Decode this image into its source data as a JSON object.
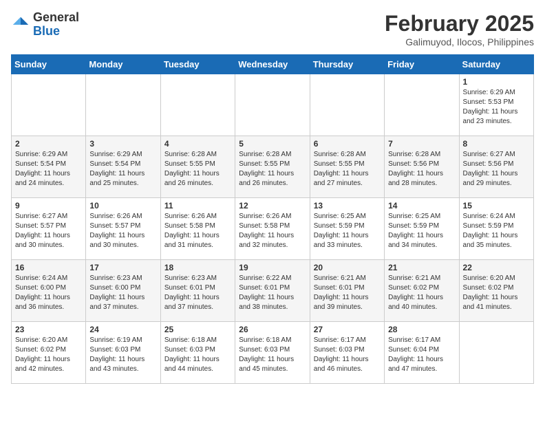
{
  "header": {
    "logo_line1": "General",
    "logo_line2": "Blue",
    "title": "February 2025",
    "subtitle": "Galimuyod, Ilocos, Philippines"
  },
  "calendar": {
    "days_of_week": [
      "Sunday",
      "Monday",
      "Tuesday",
      "Wednesday",
      "Thursday",
      "Friday",
      "Saturday"
    ],
    "weeks": [
      [
        {
          "day": "",
          "info": ""
        },
        {
          "day": "",
          "info": ""
        },
        {
          "day": "",
          "info": ""
        },
        {
          "day": "",
          "info": ""
        },
        {
          "day": "",
          "info": ""
        },
        {
          "day": "",
          "info": ""
        },
        {
          "day": "1",
          "info": "Sunrise: 6:29 AM\nSunset: 5:53 PM\nDaylight: 11 hours and 23 minutes."
        }
      ],
      [
        {
          "day": "2",
          "info": "Sunrise: 6:29 AM\nSunset: 5:54 PM\nDaylight: 11 hours and 24 minutes."
        },
        {
          "day": "3",
          "info": "Sunrise: 6:29 AM\nSunset: 5:54 PM\nDaylight: 11 hours and 25 minutes."
        },
        {
          "day": "4",
          "info": "Sunrise: 6:28 AM\nSunset: 5:55 PM\nDaylight: 11 hours and 26 minutes."
        },
        {
          "day": "5",
          "info": "Sunrise: 6:28 AM\nSunset: 5:55 PM\nDaylight: 11 hours and 26 minutes."
        },
        {
          "day": "6",
          "info": "Sunrise: 6:28 AM\nSunset: 5:55 PM\nDaylight: 11 hours and 27 minutes."
        },
        {
          "day": "7",
          "info": "Sunrise: 6:28 AM\nSunset: 5:56 PM\nDaylight: 11 hours and 28 minutes."
        },
        {
          "day": "8",
          "info": "Sunrise: 6:27 AM\nSunset: 5:56 PM\nDaylight: 11 hours and 29 minutes."
        }
      ],
      [
        {
          "day": "9",
          "info": "Sunrise: 6:27 AM\nSunset: 5:57 PM\nDaylight: 11 hours and 30 minutes."
        },
        {
          "day": "10",
          "info": "Sunrise: 6:26 AM\nSunset: 5:57 PM\nDaylight: 11 hours and 30 minutes."
        },
        {
          "day": "11",
          "info": "Sunrise: 6:26 AM\nSunset: 5:58 PM\nDaylight: 11 hours and 31 minutes."
        },
        {
          "day": "12",
          "info": "Sunrise: 6:26 AM\nSunset: 5:58 PM\nDaylight: 11 hours and 32 minutes."
        },
        {
          "day": "13",
          "info": "Sunrise: 6:25 AM\nSunset: 5:59 PM\nDaylight: 11 hours and 33 minutes."
        },
        {
          "day": "14",
          "info": "Sunrise: 6:25 AM\nSunset: 5:59 PM\nDaylight: 11 hours and 34 minutes."
        },
        {
          "day": "15",
          "info": "Sunrise: 6:24 AM\nSunset: 5:59 PM\nDaylight: 11 hours and 35 minutes."
        }
      ],
      [
        {
          "day": "16",
          "info": "Sunrise: 6:24 AM\nSunset: 6:00 PM\nDaylight: 11 hours and 36 minutes."
        },
        {
          "day": "17",
          "info": "Sunrise: 6:23 AM\nSunset: 6:00 PM\nDaylight: 11 hours and 37 minutes."
        },
        {
          "day": "18",
          "info": "Sunrise: 6:23 AM\nSunset: 6:01 PM\nDaylight: 11 hours and 37 minutes."
        },
        {
          "day": "19",
          "info": "Sunrise: 6:22 AM\nSunset: 6:01 PM\nDaylight: 11 hours and 38 minutes."
        },
        {
          "day": "20",
          "info": "Sunrise: 6:21 AM\nSunset: 6:01 PM\nDaylight: 11 hours and 39 minutes."
        },
        {
          "day": "21",
          "info": "Sunrise: 6:21 AM\nSunset: 6:02 PM\nDaylight: 11 hours and 40 minutes."
        },
        {
          "day": "22",
          "info": "Sunrise: 6:20 AM\nSunset: 6:02 PM\nDaylight: 11 hours and 41 minutes."
        }
      ],
      [
        {
          "day": "23",
          "info": "Sunrise: 6:20 AM\nSunset: 6:02 PM\nDaylight: 11 hours and 42 minutes."
        },
        {
          "day": "24",
          "info": "Sunrise: 6:19 AM\nSunset: 6:03 PM\nDaylight: 11 hours and 43 minutes."
        },
        {
          "day": "25",
          "info": "Sunrise: 6:18 AM\nSunset: 6:03 PM\nDaylight: 11 hours and 44 minutes."
        },
        {
          "day": "26",
          "info": "Sunrise: 6:18 AM\nSunset: 6:03 PM\nDaylight: 11 hours and 45 minutes."
        },
        {
          "day": "27",
          "info": "Sunrise: 6:17 AM\nSunset: 6:03 PM\nDaylight: 11 hours and 46 minutes."
        },
        {
          "day": "28",
          "info": "Sunrise: 6:17 AM\nSunset: 6:04 PM\nDaylight: 11 hours and 47 minutes."
        },
        {
          "day": "",
          "info": ""
        }
      ]
    ]
  }
}
